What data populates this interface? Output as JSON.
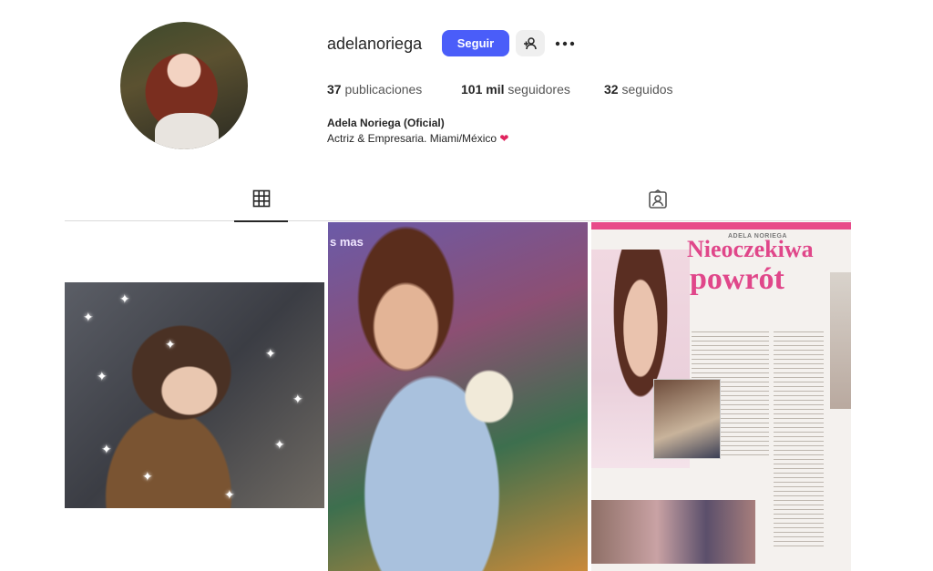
{
  "profile": {
    "username": "adelanoriega",
    "follow_label": "Seguir",
    "posts_count": "37",
    "posts_label": "publicaciones",
    "followers_count": "101 mil",
    "followers_label": "seguidores",
    "following_count": "32",
    "following_label": "seguidos",
    "full_name": "Adela Noriega (Oficial)",
    "bio": "Actriz & Empresaria. Miami/México",
    "bio_emoji": "❤"
  },
  "tabs": {
    "posts_icon": "grid-icon",
    "tagged_icon": "tagged-user-icon"
  },
  "posts": {
    "post2_tag": "s mas",
    "post3_kicker": "ADELA NORIEGA",
    "post3_headline1": "Nieoczekiwa",
    "post3_headline2": "powrót"
  },
  "colors": {
    "accent": "#4a5df9",
    "heart": "#e0245e",
    "magazine_pink": "#e0478a"
  }
}
